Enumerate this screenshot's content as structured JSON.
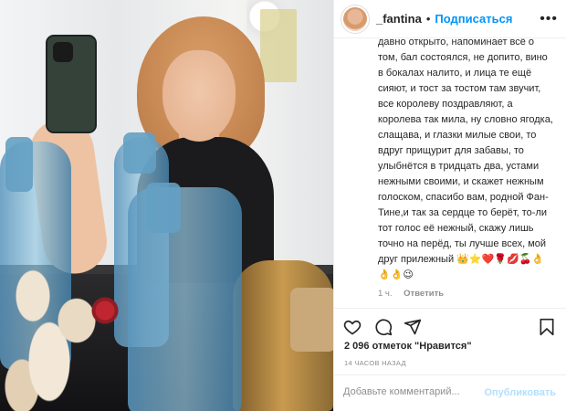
{
  "header": {
    "username": "_fantina",
    "separator": "•",
    "follow_label": "Подписаться",
    "more_label": "•••"
  },
  "post": {
    "caption": "давно открыто, напоминает всё о том, бал состоялся, не допито, вино в бокалах налито, и лица те ещё сияют, и тост за тостом там звучит, все королеву поздравляют, а королева так мила, ну словно ягодка, слащава, и глазки милые свои, то вдруг прищурит для забавы, то улыбнётся в тридцать два, устами нежными своими, и скажет нежным голоском, спасибо вам, родной Фан-Тине,и так за сердце то берёт, то-ли тот голос её нежный, скажу лишь точно на перёд, ты лучше всех, мой друг прилежный 👑⭐❤️🌹💋🍒👌 👌👌😉",
    "time_ago": "1 ч.",
    "reply_label": "Ответить",
    "likes": "2 096 отметок \"Нравится\"",
    "timestamp": "14 ЧАСОВ НАЗАД"
  },
  "comment_box": {
    "placeholder": "Добавьте комментарий...",
    "publish_label": "Опубликовать"
  },
  "icons": {
    "like": "heart-icon",
    "comment": "comment-icon",
    "share": "share-icon",
    "save": "bookmark-icon"
  }
}
